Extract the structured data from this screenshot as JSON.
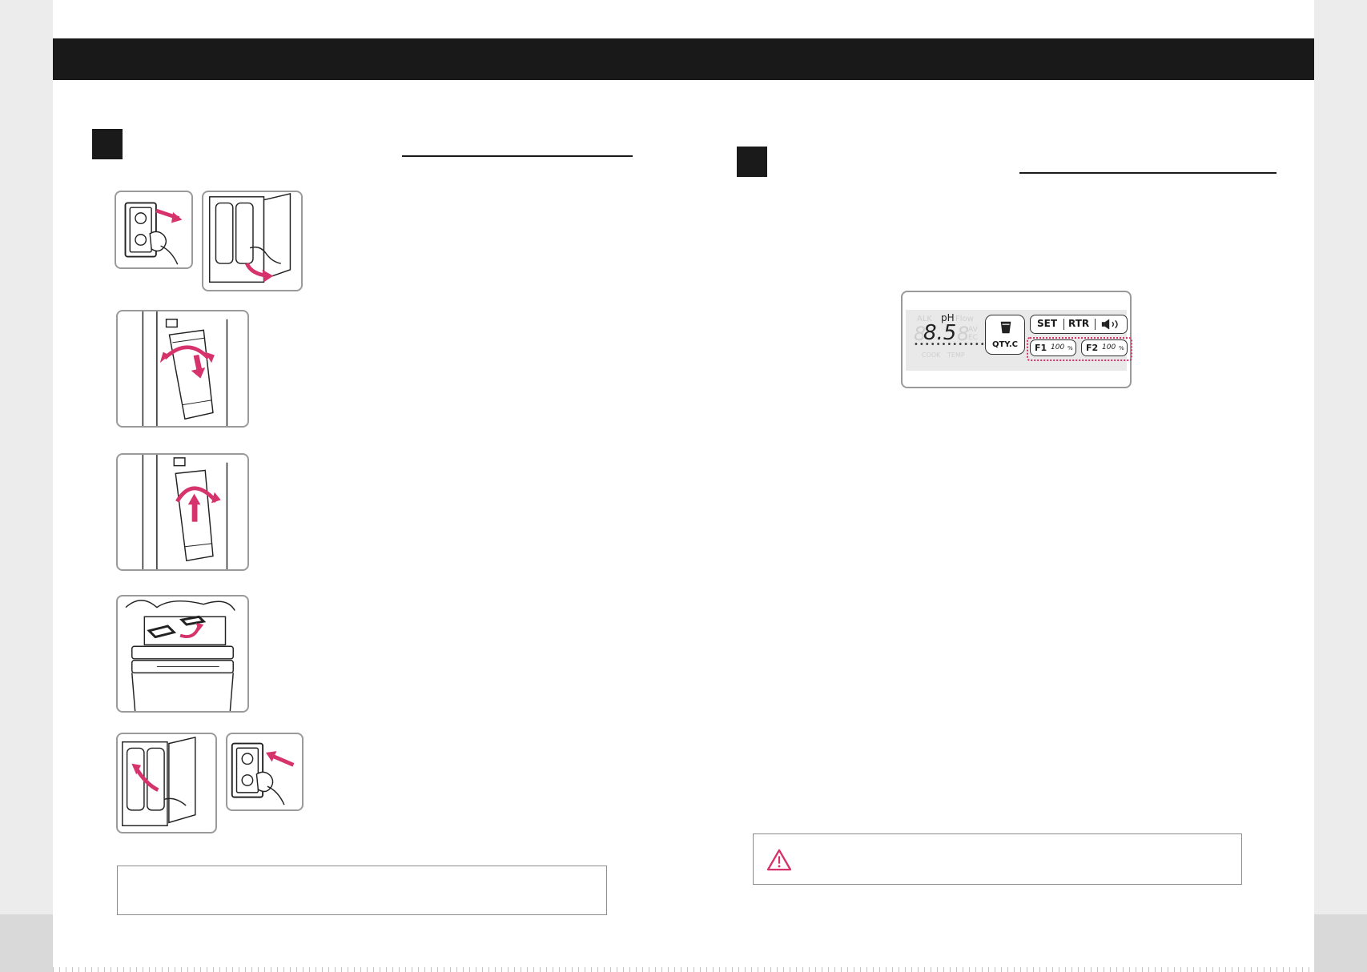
{
  "panel": {
    "left_labels": {
      "alk": "ALK",
      "ph": "pH",
      "flow": "Flow",
      "av": "AV",
      "ec": "EC",
      "cook": "COOK",
      "temp": "TEMP"
    },
    "display_value": "8.5",
    "qty_label": "QTY.C",
    "set_label": "SET",
    "rtr_label": "RTR",
    "f1_label": "F1",
    "f1_value": "100",
    "f2_label": "F2",
    "f2_value": "100",
    "percent": "%"
  },
  "colors": {
    "accent": "#d6336c",
    "header": "#191919"
  },
  "icons": [
    "plug-icon",
    "arrow-icon",
    "speaker-icon",
    "cup-icon",
    "warning-icon"
  ]
}
